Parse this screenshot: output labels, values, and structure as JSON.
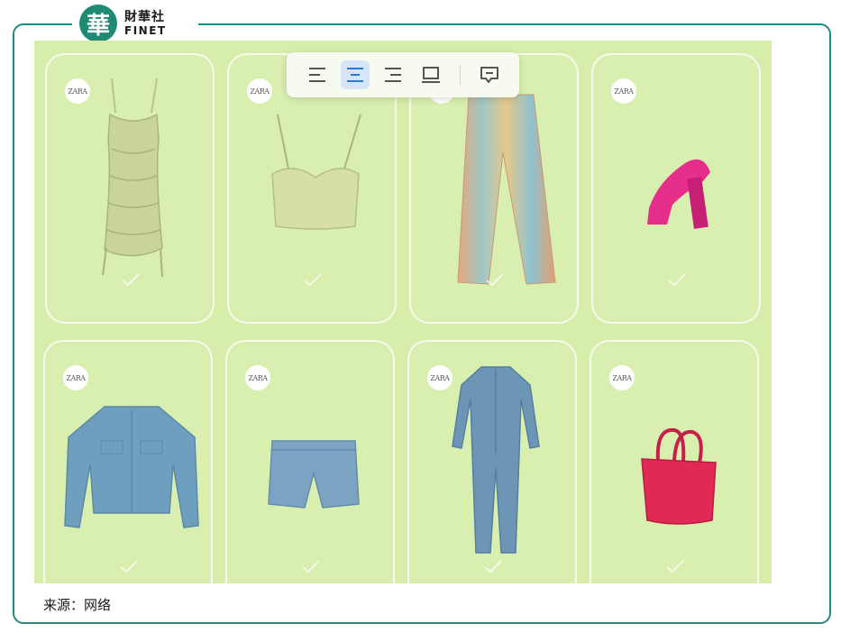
{
  "brand": {
    "logo_char": "華",
    "name_cn": "財華社",
    "name_en": "FINET",
    "accent_color": "#23897f"
  },
  "toolbar": {
    "buttons": [
      {
        "icon": "align-left-icon",
        "active": false
      },
      {
        "icon": "align-center-icon",
        "active": true
      },
      {
        "icon": "align-right-icon",
        "active": false
      },
      {
        "icon": "display-block-icon",
        "active": false
      },
      {
        "icon": "comment-icon",
        "active": false
      }
    ]
  },
  "products": [
    {
      "brand_badge": "ZARA",
      "item": "slip-dress-icon",
      "color": "#c9d49a"
    },
    {
      "brand_badge": "ZARA",
      "item": "crop-top-icon",
      "color": "#d7dfa8"
    },
    {
      "brand_badge": "ZARA",
      "item": "gradient-jeans-icon",
      "color": "#e6a77a"
    },
    {
      "brand_badge": "ZARA",
      "item": "platform-heel-icon",
      "color": "#e62f8a"
    },
    {
      "brand_badge": "ZARA",
      "item": "denim-jacket-icon",
      "color": "#6f9fbe"
    },
    {
      "brand_badge": "ZARA",
      "item": "denim-shorts-icon",
      "color": "#7aa4c2"
    },
    {
      "brand_badge": "ZARA",
      "item": "denim-jumpsuit-icon",
      "color": "#6c95b6"
    },
    {
      "brand_badge": "ZARA",
      "item": "tote-bag-icon",
      "color": "#e02a55"
    }
  ],
  "caption": "来源：网络"
}
